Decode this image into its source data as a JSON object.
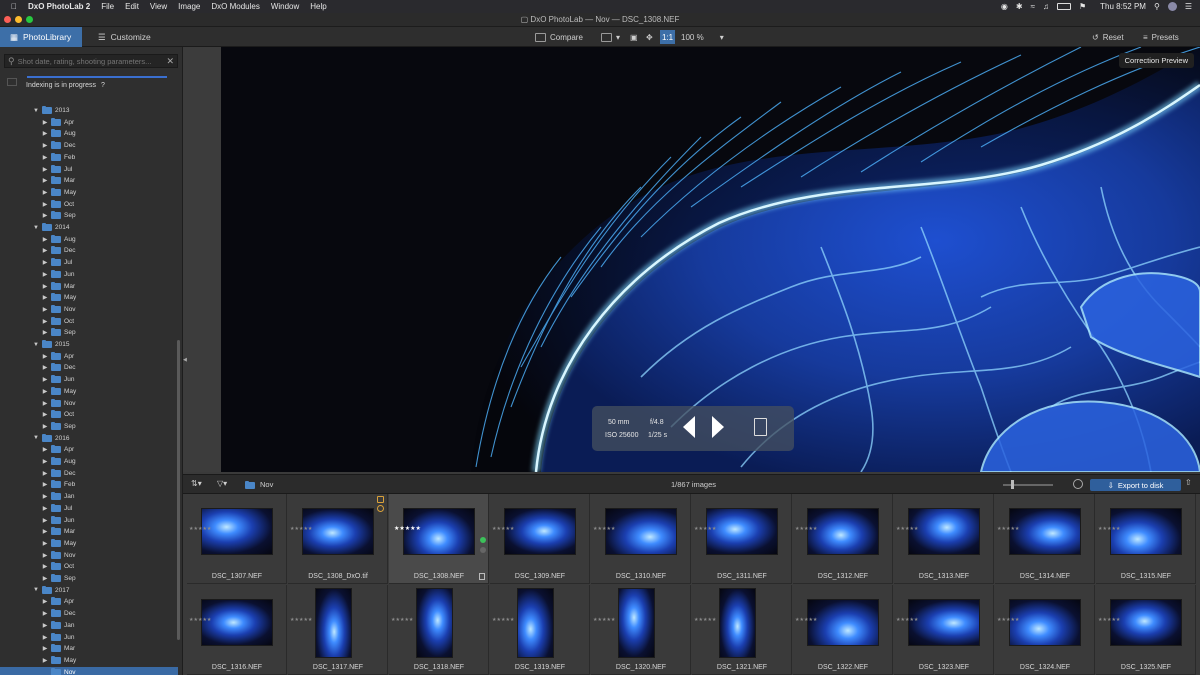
{
  "menubar": {
    "app": "DxO PhotoLab 2",
    "items": [
      "File",
      "Edit",
      "View",
      "Image",
      "DxO Modules",
      "Window",
      "Help"
    ],
    "clock": "Thu 8:52 PM"
  },
  "window": {
    "title": "DxO PhotoLab — Nov — DSC_1308.NEF"
  },
  "toolbar": {
    "tab_library": "PhotoLibrary",
    "tab_customize": "Customize",
    "compare": "Compare",
    "zoom": "100 %",
    "reset": "Reset",
    "presets": "Presets"
  },
  "sidebar": {
    "search_placeholder": "Shot date, rating, shooting parameters...",
    "indexing": "Indexing is in progress",
    "indexing_help": "?",
    "tree": [
      {
        "label": "2013",
        "level": 0
      },
      {
        "label": "Apr",
        "level": 1
      },
      {
        "label": "Aug",
        "level": 1
      },
      {
        "label": "Dec",
        "level": 1
      },
      {
        "label": "Feb",
        "level": 1
      },
      {
        "label": "Jul",
        "level": 1
      },
      {
        "label": "Mar",
        "level": 1
      },
      {
        "label": "May",
        "level": 1
      },
      {
        "label": "Oct",
        "level": 1
      },
      {
        "label": "Sep",
        "level": 1
      },
      {
        "label": "2014",
        "level": 0
      },
      {
        "label": "Aug",
        "level": 1
      },
      {
        "label": "Dec",
        "level": 1
      },
      {
        "label": "Jul",
        "level": 1
      },
      {
        "label": "Jun",
        "level": 1
      },
      {
        "label": "Mar",
        "level": 1
      },
      {
        "label": "May",
        "level": 1
      },
      {
        "label": "Nov",
        "level": 1
      },
      {
        "label": "Oct",
        "level": 1
      },
      {
        "label": "Sep",
        "level": 1
      },
      {
        "label": "2015",
        "level": 0
      },
      {
        "label": "Apr",
        "level": 1
      },
      {
        "label": "Dec",
        "level": 1
      },
      {
        "label": "Jun",
        "level": 1
      },
      {
        "label": "May",
        "level": 1
      },
      {
        "label": "Nov",
        "level": 1
      },
      {
        "label": "Oct",
        "level": 1
      },
      {
        "label": "Sep",
        "level": 1
      },
      {
        "label": "2016",
        "level": 0
      },
      {
        "label": "Apr",
        "level": 1
      },
      {
        "label": "Aug",
        "level": 1
      },
      {
        "label": "Dec",
        "level": 1
      },
      {
        "label": "Feb",
        "level": 1
      },
      {
        "label": "Jan",
        "level": 1
      },
      {
        "label": "Jul",
        "level": 1
      },
      {
        "label": "Jun",
        "level": 1
      },
      {
        "label": "Mar",
        "level": 1
      },
      {
        "label": "May",
        "level": 1
      },
      {
        "label": "Nov",
        "level": 1
      },
      {
        "label": "Oct",
        "level": 1
      },
      {
        "label": "Sep",
        "level": 1
      },
      {
        "label": "2017",
        "level": 0
      },
      {
        "label": "Apr",
        "level": 1
      },
      {
        "label": "Dec",
        "level": 1
      },
      {
        "label": "Jan",
        "level": 1
      },
      {
        "label": "Jun",
        "level": 1
      },
      {
        "label": "Mar",
        "level": 1
      },
      {
        "label": "May",
        "level": 1
      },
      {
        "label": "Nov",
        "level": 1,
        "selected": true
      }
    ]
  },
  "viewer": {
    "correction_preview": "Correction Preview",
    "hud": {
      "focal": "50 mm",
      "aperture": "f/4.8",
      "iso": "ISO 25600",
      "shutter": "1/25 s"
    }
  },
  "filmstrip": {
    "folder": "Nov",
    "count": "1/867 images",
    "export": "Export to disk",
    "images": [
      {
        "name": "DSC_1307.NEF",
        "shape": "landscape"
      },
      {
        "name": "DSC_1308_DxO.tif",
        "shape": "landscape"
      },
      {
        "name": "DSC_1308.NEF",
        "shape": "landscape",
        "selected": true
      },
      {
        "name": "DSC_1309.NEF",
        "shape": "landscape"
      },
      {
        "name": "DSC_1310.NEF",
        "shape": "landscape"
      },
      {
        "name": "DSC_1311.NEF",
        "shape": "landscape"
      },
      {
        "name": "DSC_1312.NEF",
        "shape": "landscape"
      },
      {
        "name": "DSC_1313.NEF",
        "shape": "landscape"
      },
      {
        "name": "DSC_1314.NEF",
        "shape": "landscape"
      },
      {
        "name": "DSC_1315.NEF",
        "shape": "landscape"
      },
      {
        "name": "DSC_1316.NEF",
        "shape": "landscape"
      },
      {
        "name": "DSC_1317.NEF",
        "shape": "portrait"
      },
      {
        "name": "DSC_1318.NEF",
        "shape": "portrait"
      },
      {
        "name": "DSC_1319.NEF",
        "shape": "portrait"
      },
      {
        "name": "DSC_1320.NEF",
        "shape": "portrait"
      },
      {
        "name": "DSC_1321.NEF",
        "shape": "portrait"
      },
      {
        "name": "DSC_1322.NEF",
        "shape": "landscape"
      },
      {
        "name": "DSC_1323.NEF",
        "shape": "landscape"
      },
      {
        "name": "DSC_1324.NEF",
        "shape": "landscape"
      },
      {
        "name": "DSC_1325.NEF",
        "shape": "landscape"
      }
    ]
  },
  "colors": {
    "accent": "#3d6fa8",
    "folder": "#4a86c7",
    "jelly": "#3f8cff"
  }
}
